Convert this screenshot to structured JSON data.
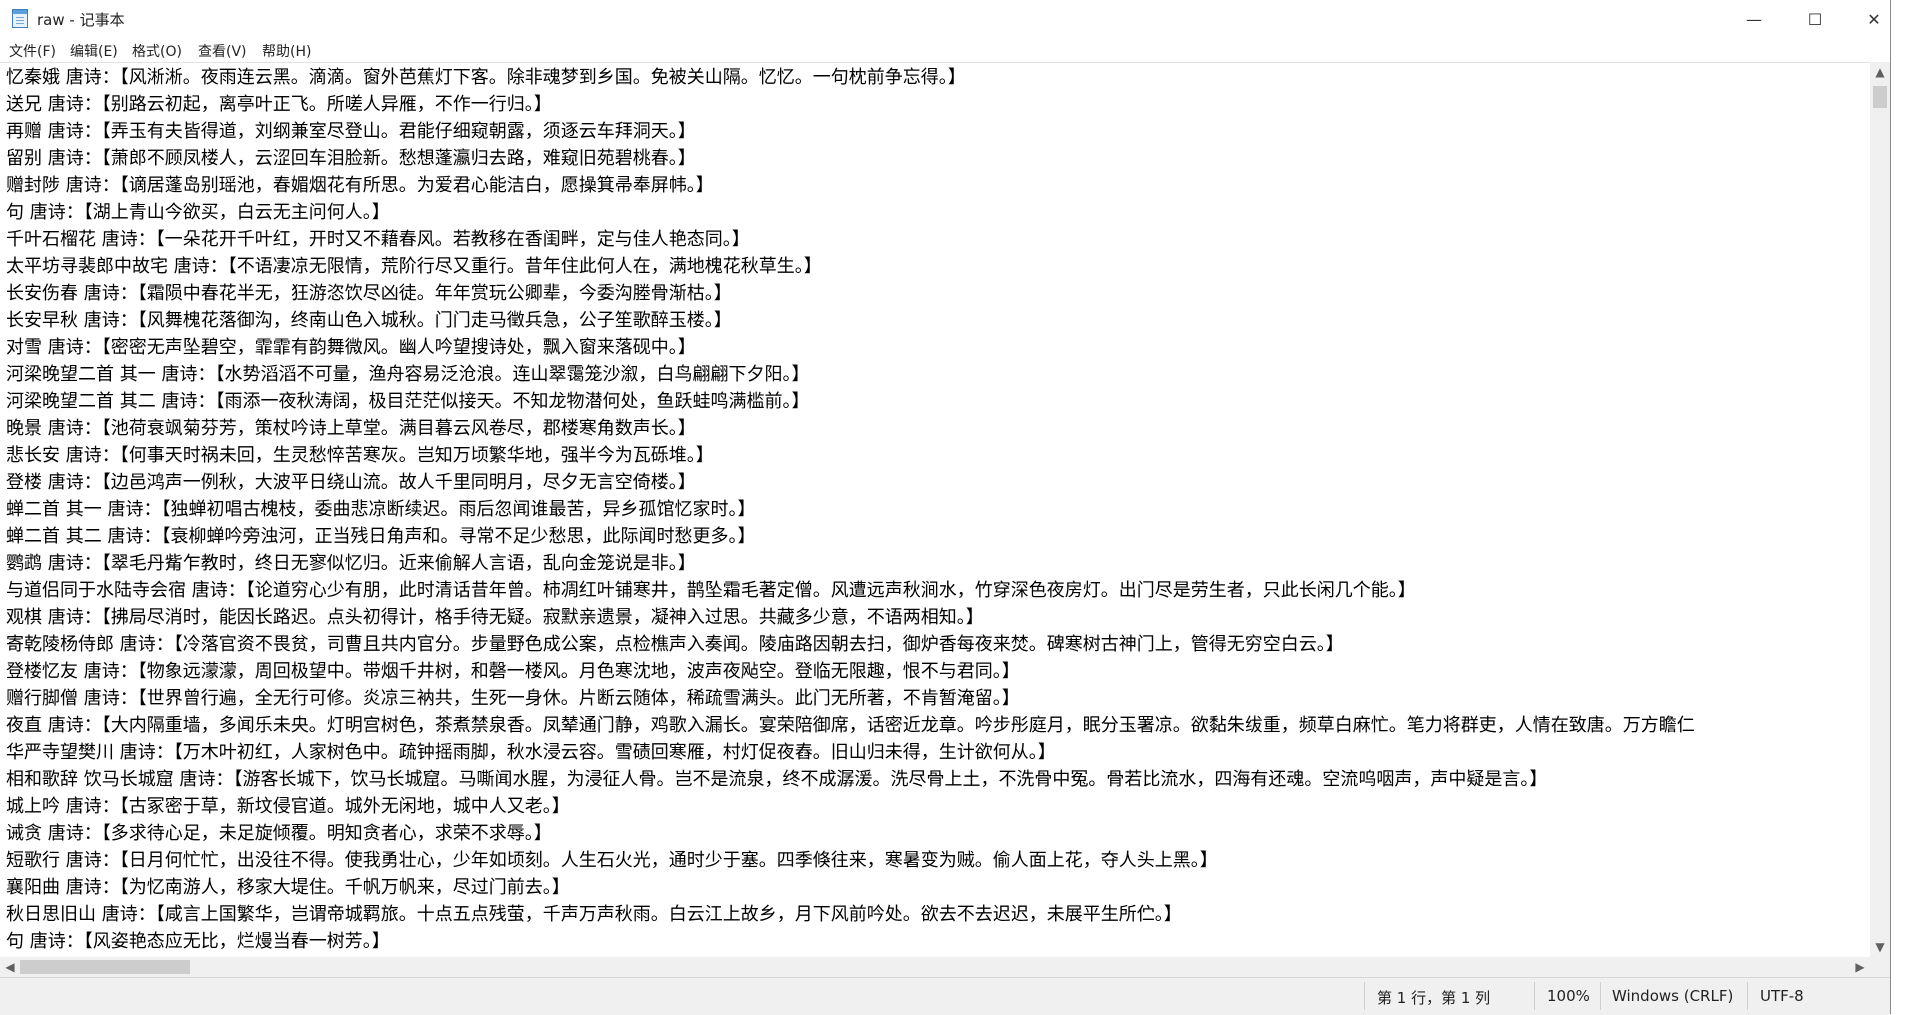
{
  "window": {
    "title": "raw - 记事本"
  },
  "controls": {
    "minimize": "—",
    "maximize": "☐",
    "close": "✕"
  },
  "menu": [
    "文件(F)",
    "编辑(E)",
    "格式(O)",
    "查看(V)",
    "帮助(H)"
  ],
  "editor": {
    "lines": [
      "忆秦娥 唐诗：【风淅淅。夜雨连云黑。滴滴。窗外芭蕉灯下客。除非魂梦到乡国。免被关山隔。忆忆。一句枕前争忘得。】",
      "送兄 唐诗：【别路云初起，离亭叶正飞。所嗟人异雁，不作一行归。】",
      "再赠 唐诗：【弄玉有夫皆得道，刘纲兼室尽登山。君能仔细窥朝露，须逐云车拜洞天。】",
      "留别 唐诗：【萧郎不顾凤楼人，云涩回车泪脸新。愁想蓬瀛归去路，难窥旧苑碧桃春。】",
      "赠封陟 唐诗：【谪居蓬岛别瑶池，春媚烟花有所思。为爱君心能洁白，愿操箕帚奉屏帏。】",
      "句 唐诗：【湖上青山今欲买，白云无主问何人。】",
      "千叶石榴花 唐诗：【一朵花开千叶红，开时又不藉春风。若教移在香闺畔，定与佳人艳态同。】",
      "太平坊寻裴郎中故宅 唐诗：【不语凄凉无限情，荒阶行尽又重行。昔年住此何人在，满地槐花秋草生。】",
      "长安伤春 唐诗：【霜陨中春花半无，狂游恣饮尽凶徒。年年赏玩公卿辈，今委沟塍骨渐枯。】",
      "长安早秋 唐诗：【风舞槐花落御沟，终南山色入城秋。门门走马徵兵急，公子笙歌醉玉楼。】",
      "对雪 唐诗：【密密无声坠碧空，霏霏有韵舞微风。幽人吟望搜诗处，飘入窗来落砚中。】",
      "河梁晚望二首 其一 唐诗：【水势滔滔不可量，渔舟容易泛沧浪。连山翠霭笼沙溆，白鸟翩翩下夕阳。】",
      "河梁晚望二首 其二 唐诗：【雨添一夜秋涛阔，极目茫茫似接天。不知龙物潜何处，鱼跃蛙鸣满槛前。】",
      "晚景 唐诗：【池荷衰飒菊芬芳，策杖吟诗上草堂。满目暮云风卷尽，郡楼寒角数声长。】",
      "悲长安 唐诗：【何事天时祸未回，生灵愁悴苦寒灰。岂知万顷繁华地，强半今为瓦砾堆。】",
      "登楼 唐诗：【边邑鸿声一例秋，大波平日绕山流。故人千里同明月，尽夕无言空倚楼。】",
      "蝉二首 其一 唐诗：【独蝉初唱古槐枝，委曲悲凉断续迟。雨后忽闻谁最苦，异乡孤馆忆家时。】",
      "蝉二首 其二 唐诗：【衰柳蝉吟旁浊河，正当残日角声和。寻常不足少愁思，此际闻时愁更多。】",
      "鹦鹉 唐诗：【翠毛丹觜乍教时，终日无寥似忆归。近来偷解人言语，乱向金笼说是非。】",
      "与道侣同于水陆寺会宿 唐诗：【论道穷心少有朋，此时清话昔年曾。柿凋红叶铺寒井，鹊坠霜毛著定僧。风遭远声秋涧水，竹穿深色夜房灯。出门尽是劳生者，只此长闲几个能。】",
      "观棋 唐诗：【拂局尽消时，能因长路迟。点头初得计，格手待无疑。寂默亲遗景，凝神入过思。共藏多少意，不语两相知。】",
      "寄乾陵杨侍郎 唐诗：【冷落官资不畏贫，司曹且共内官分。步量野色成公案，点检樵声入奏闻。陵庙路因朝去扫，御炉香每夜来焚。碑寒树古神门上，管得无穷空白云。】",
      "登楼忆友 唐诗：【物象远濛濛，周回极望中。带烟千井树，和磬一楼风。月色寒沈地，波声夜飐空。登临无限趣，恨不与君同。】",
      "赠行脚僧 唐诗：【世界曾行遍，全无行可修。炎凉三衲共，生死一身休。片断云随体，稀疏雪满头。此门无所著，不肯暂淹留。】",
      "夜直 唐诗：【大内隔重墙，多闻乐未央。灯明宫树色，茶煮禁泉香。凤辇通门静，鸡歌入漏长。宴荣陪御席，话密近龙章。吟步彤庭月，眠分玉署凉。欲黏朱绂重，频草白麻忙。笔力将群吏，人情在致唐。万方瞻仁",
      "华严寺望樊川 唐诗：【万木叶初红，人家树色中。疏钟摇雨脚，秋水浸云容。雪碛回寒雁，村灯促夜舂。旧山归未得，生计欲何从。】",
      "相和歌辞 饮马长城窟 唐诗：【游客长城下，饮马长城窟。马嘶闻水腥，为浸征人骨。岂不是流泉，终不成潺湲。洗尽骨上土，不洗骨中冤。骨若比流水，四海有还魂。空流呜咽声，声中疑是言。】",
      "城上吟 唐诗：【古冢密于草，新坟侵官道。城外无闲地，城中人又老。】",
      "诫贪 唐诗：【多求待心足，未足旋倾覆。明知贪者心，求荣不求辱。】",
      "短歌行 唐诗：【日月何忙忙，出没往不得。使我勇壮心，少年如顷刻。人生石火光，通时少于塞。四季倏往来，寒暑变为贼。偷人面上花，夺人头上黑。】",
      "襄阳曲 唐诗：【为忆南游人，移家大堤住。千帆万帆来，尽过门前去。】",
      "秋日思旧山 唐诗：【咸言上国繁华，岂谓帝城羁旅。十点五点残萤，千声万声秋雨。白云江上故乡，月下风前吟处。欲去不去迟迟，未展平生所伫。】",
      "句 唐诗：【风姿艳态应无比，烂熳当春一树芳。】"
    ]
  },
  "statusbar": {
    "position": "第 1 行，第 1 列",
    "zoom": "100%",
    "line_ending": "Windows (CRLF)",
    "encoding": "UTF-8"
  }
}
